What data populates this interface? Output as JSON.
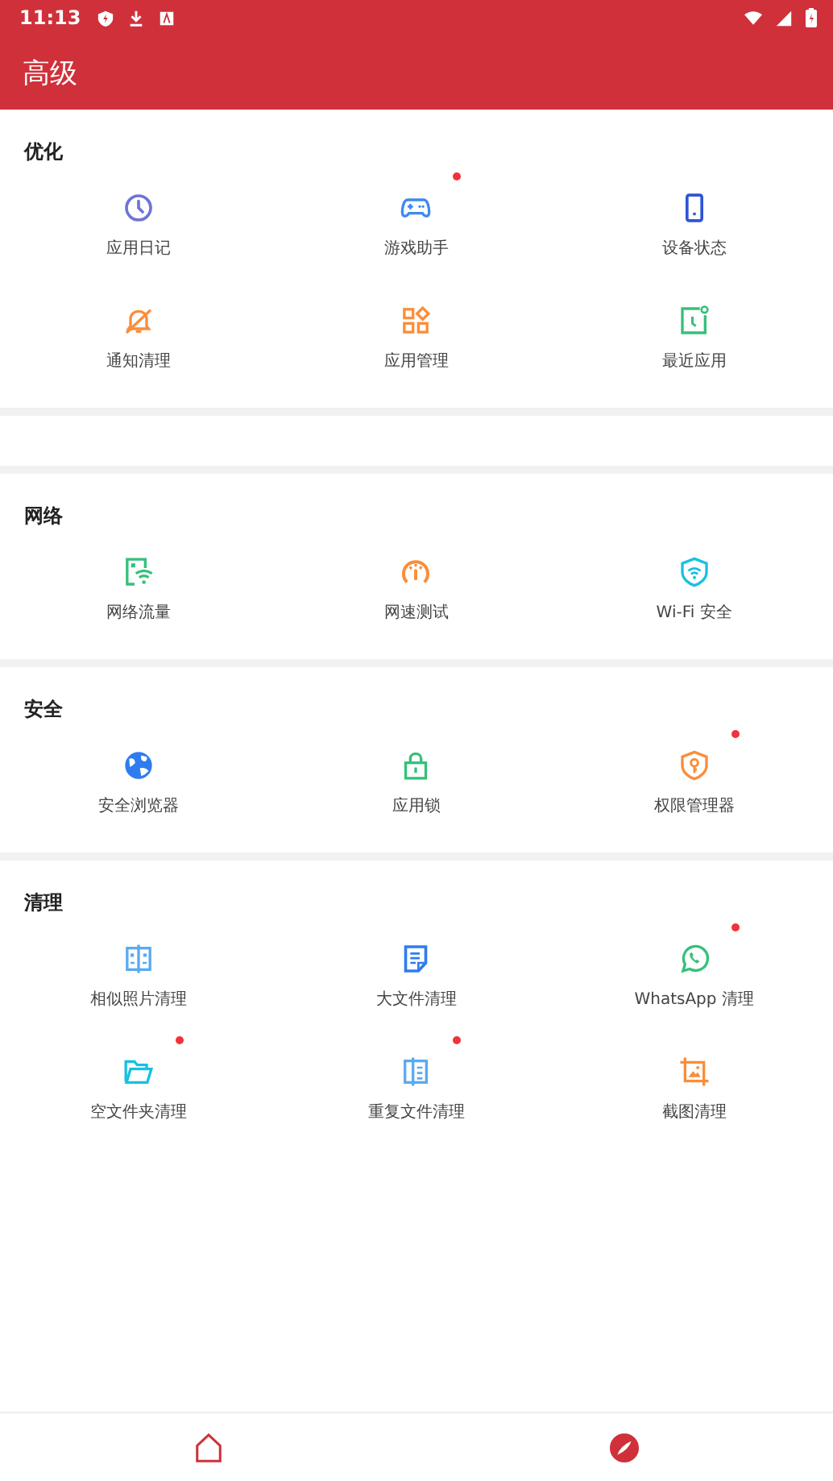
{
  "status_bar": {
    "time": "11:13"
  },
  "app_bar": {
    "title": "高级"
  },
  "sections": [
    {
      "title": "优化",
      "items": [
        {
          "label": "应用日记",
          "badge": false
        },
        {
          "label": "游戏助手",
          "badge": true
        },
        {
          "label": "设备状态",
          "badge": false
        },
        {
          "label": "通知清理",
          "badge": false
        },
        {
          "label": "应用管理",
          "badge": false
        },
        {
          "label": "最近应用",
          "badge": false
        }
      ]
    },
    {
      "kind": "empty"
    },
    {
      "title": "网络",
      "items": [
        {
          "label": "网络流量",
          "badge": false
        },
        {
          "label": "网速测试",
          "badge": false
        },
        {
          "label": "Wi-Fi 安全",
          "badge": false
        }
      ]
    },
    {
      "title": "安全",
      "items": [
        {
          "label": "安全浏览器",
          "badge": false
        },
        {
          "label": "应用锁",
          "badge": false
        },
        {
          "label": "权限管理器",
          "badge": true
        }
      ]
    },
    {
      "title": "清理",
      "items": [
        {
          "label": "相似照片清理",
          "badge": false
        },
        {
          "label": "大文件清理",
          "badge": false
        },
        {
          "label": "WhatsApp 清理",
          "badge": true
        },
        {
          "label": "空文件夹清理",
          "badge": true
        },
        {
          "label": "重复文件清理",
          "badge": true
        },
        {
          "label": "截图清理",
          "badge": false
        }
      ]
    }
  ]
}
